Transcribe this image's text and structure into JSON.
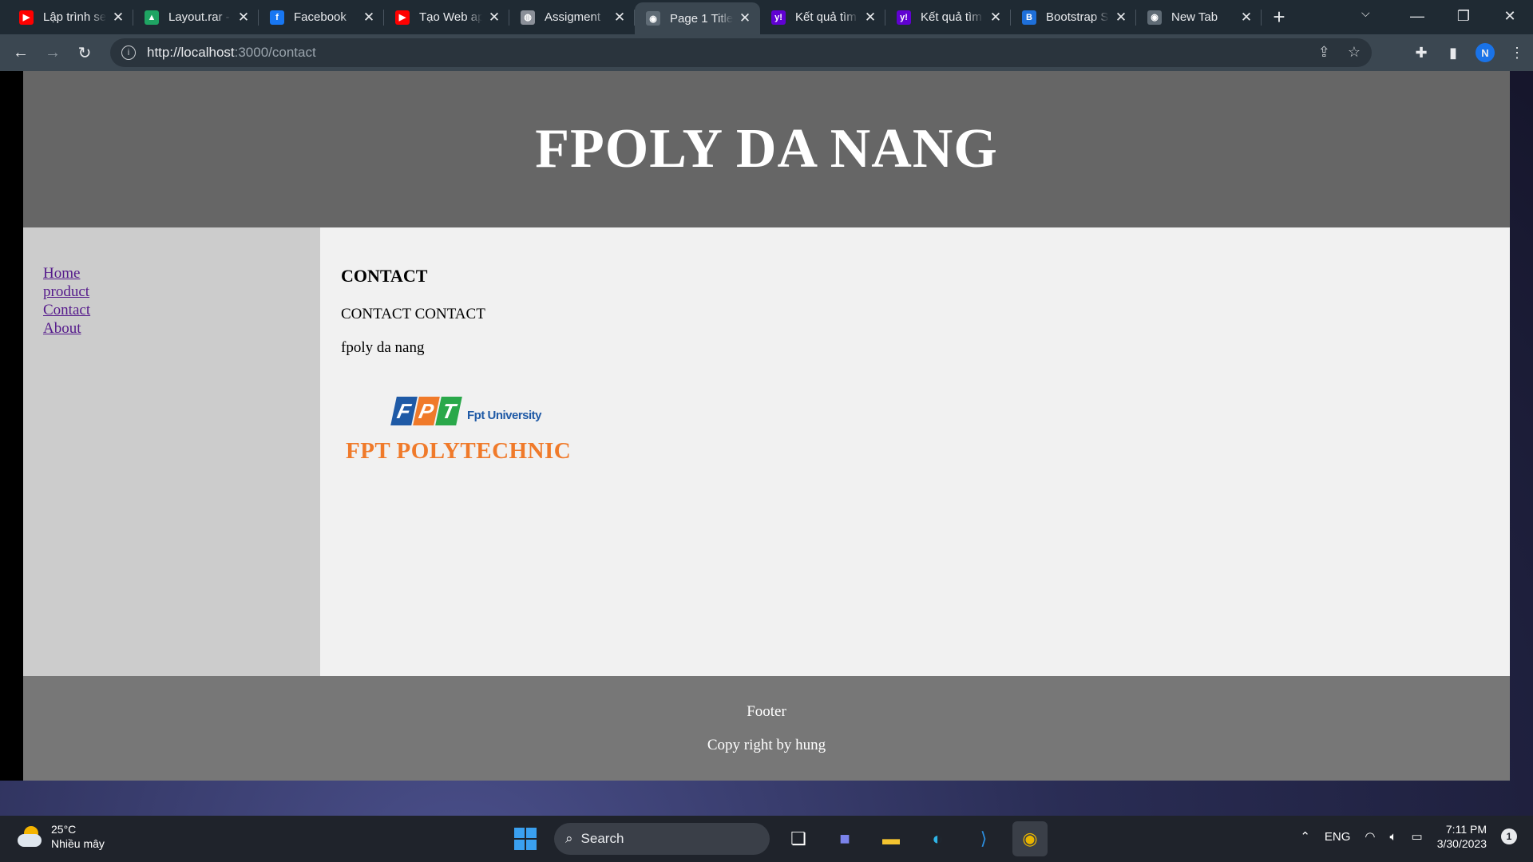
{
  "browser": {
    "tabs": [
      {
        "title": "Lập trình se",
        "favicon_color": "#ff0000",
        "favicon_glyph": "▶",
        "icon": "youtube-icon"
      },
      {
        "title": "Layout.rar -",
        "favicon_color": "#1fa463",
        "favicon_glyph": "▲",
        "icon": "drive-icon"
      },
      {
        "title": "Facebook",
        "favicon_color": "#1877f2",
        "favicon_glyph": "f",
        "icon": "facebook-icon"
      },
      {
        "title": "Tạo Web ap",
        "favicon_color": "#ff0000",
        "favicon_glyph": "▶",
        "icon": "youtube-icon"
      },
      {
        "title": "Assigment",
        "favicon_color": "#8a8f98",
        "favicon_glyph": "◍",
        "icon": "classroom-icon"
      },
      {
        "title": "Page 1 Title",
        "favicon_color": "#5f6b75",
        "favicon_glyph": "◉",
        "icon": "globe-icon",
        "active": true
      },
      {
        "title": "Kết quả tìm",
        "favicon_color": "#6001d2",
        "favicon_glyph": "y!",
        "icon": "yahoo-icon"
      },
      {
        "title": "Kết quả tìm",
        "favicon_color": "#6001d2",
        "favicon_glyph": "y!",
        "icon": "yahoo-icon"
      },
      {
        "title": "Bootstrap S",
        "favicon_color": "#1e6fd9",
        "favicon_glyph": "B",
        "icon": "bootstrap-icon"
      },
      {
        "title": "New Tab",
        "favicon_color": "#5f6b75",
        "favicon_glyph": "◉",
        "icon": "globe-icon"
      }
    ],
    "url_host": "http://localhost",
    "url_rest": ":3000/contact",
    "profile_initial": "N"
  },
  "page": {
    "header_title": "FPOLY DA NANG",
    "nav": [
      "Home",
      "product",
      "Contact",
      "About"
    ],
    "main_heading": "CONTACT",
    "paragraphs": [
      "CONTACT CONTACT",
      "fpoly da nang"
    ],
    "logo": {
      "letters": [
        "F",
        "P",
        "T"
      ],
      "letter_colors": [
        "#1f5aa6",
        "#f07a2a",
        "#2aa84a"
      ],
      "university": "Fpt University",
      "brand": "FPT POLYTECHNIC"
    },
    "footer_title": "Footer",
    "footer_copy": "Copy right by hung"
  },
  "taskbar": {
    "temp": "25°C",
    "weather": "Nhiều mây",
    "search_label": "Search",
    "lang": "ENG",
    "time": "7:11 PM",
    "date": "3/30/2023",
    "notifications": "1"
  }
}
